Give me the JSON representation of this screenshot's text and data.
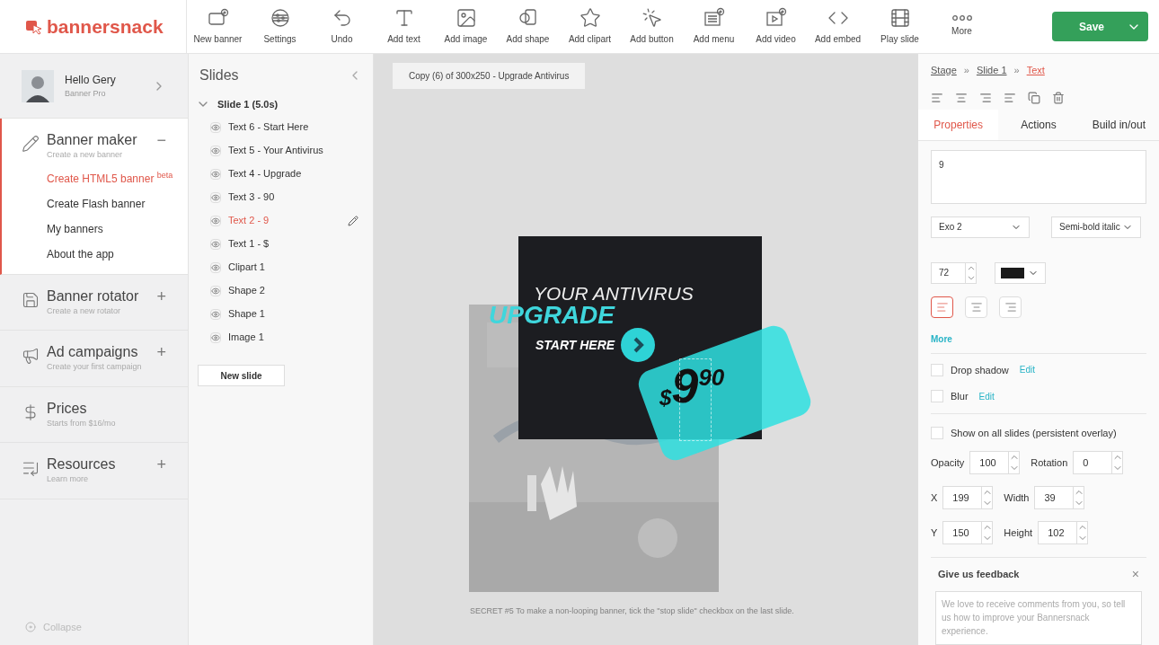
{
  "logo": {
    "text": "bannersnack"
  },
  "toolbar": [
    {
      "label": "New banner"
    },
    {
      "label": "Settings"
    },
    {
      "label": "Undo"
    },
    {
      "label": "Add text"
    },
    {
      "label": "Add image"
    },
    {
      "label": "Add shape"
    },
    {
      "label": "Add clipart"
    },
    {
      "label": "Add button"
    },
    {
      "label": "Add menu"
    },
    {
      "label": "Add video"
    },
    {
      "label": "Add embed"
    },
    {
      "label": "Play slide"
    },
    {
      "label": "More"
    }
  ],
  "save_button": {
    "label": "Save"
  },
  "profile": {
    "greeting": "Hello Gery",
    "plan": "Banner Pro"
  },
  "sidebar": {
    "sections": [
      {
        "title": "Banner maker",
        "subtitle": "Create a new banner",
        "toggle": "−",
        "expanded": true,
        "items": [
          {
            "label": "Create HTML5 banner $^{beta}$",
            "selected": true
          },
          {
            "label": "Create Flash banner",
            "selected": false
          },
          {
            "label": "My banners",
            "selected": false
          },
          {
            "label": "About the app",
            "selected": false
          }
        ]
      },
      {
        "title": "Banner rotator",
        "subtitle": "Create a new rotator",
        "toggle": "+",
        "expanded": false
      },
      {
        "title": "Ad campaigns",
        "subtitle": "Create your first campaign",
        "toggle": "+",
        "expanded": false
      },
      {
        "title": "Prices",
        "subtitle": "Starts from $16/mo",
        "expanded": false
      },
      {
        "title": "Resources",
        "subtitle": "Learn more",
        "toggle": "+",
        "expanded": false
      }
    ],
    "collapse": "Collapse"
  },
  "slides_panel": {
    "title": "Slides",
    "slide": {
      "label": "Slide 1 (5.0s)",
      "expanded": true
    },
    "layers": [
      {
        "label": "Text 6 - Start Here",
        "selected": false
      },
      {
        "label": "Text 5 - Your Antivirus",
        "selected": false
      },
      {
        "label": "Text 4 - Upgrade",
        "selected": false
      },
      {
        "label": "Text 3 - 90",
        "selected": false
      },
      {
        "label": "Text 2 - 9",
        "selected": true
      },
      {
        "label": "Text 1 - $",
        "selected": false
      },
      {
        "label": "Clipart 1",
        "selected": false
      },
      {
        "label": "Shape 2",
        "selected": false
      },
      {
        "label": "Shape 1",
        "selected": false
      },
      {
        "label": "Image 1",
        "selected": false
      }
    ],
    "new_slide": "New slide"
  },
  "canvas": {
    "document_title": "Copy (6) of 300x250 - Upgrade Antivirus",
    "banner": {
      "headline": "YOUR ANTIVIRUS",
      "upgrade": "UPGRADE",
      "cta": "START HERE",
      "currency": "$",
      "price": "9",
      "cents": "90"
    },
    "tip": "SECRET #5 To make a non-looping banner, tick the \"stop slide\" checkbox on the last slide."
  },
  "properties": {
    "breadcrumbs": [
      {
        "label": "Stage",
        "current": false
      },
      {
        "label": "Slide 1",
        "current": false
      },
      {
        "label": "Text",
        "current": true
      }
    ],
    "separator": "»",
    "tabs": [
      {
        "label": "Properties",
        "selected": true
      },
      {
        "label": "Actions",
        "selected": false
      },
      {
        "label": "Build in/out",
        "selected": false
      }
    ],
    "text_value": "9",
    "font": "Exo 2",
    "font_style": "Semi-bold italic",
    "font_size": "72",
    "color": "#1a1a1a",
    "alignments": [
      {
        "kind": "left",
        "selected": true
      },
      {
        "kind": "center",
        "selected": false
      },
      {
        "kind": "right",
        "selected": false
      }
    ],
    "more_link": "More",
    "effects": [
      {
        "label": "Drop shadow",
        "checked": false,
        "edit": "Edit"
      },
      {
        "label": "Blur",
        "checked": false,
        "edit": "Edit"
      }
    ],
    "overlay": {
      "label": "Show on all slides (persistent overlay)",
      "checked": false
    },
    "fields": [
      [
        {
          "label": "Opacity",
          "value": "100"
        },
        {
          "label": "Rotation",
          "value": "0"
        }
      ],
      [
        {
          "label": "X",
          "value": "199"
        },
        {
          "label": "Width",
          "value": "39"
        }
      ],
      [
        {
          "label": "Y",
          "value": "150"
        },
        {
          "label": "Height",
          "value": "102"
        }
      ]
    ],
    "feedback": {
      "title": "Give us feedback",
      "close": "×",
      "placeholder": "We love to receive comments from you, so tell us how to improve your Bannersnack experience."
    }
  }
}
